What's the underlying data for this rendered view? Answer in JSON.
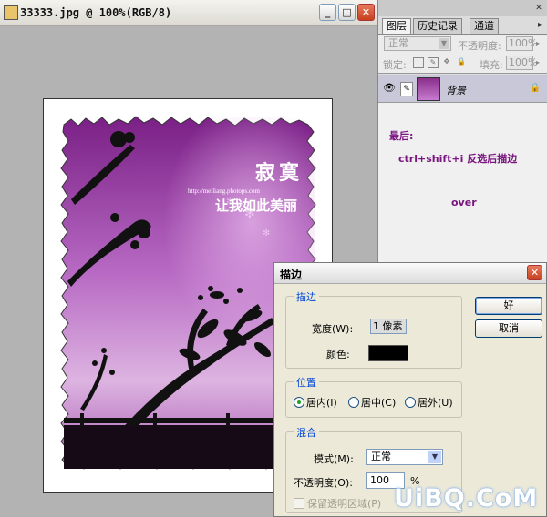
{
  "document": {
    "title": "33333.jpg @ 100%(RGB/8)",
    "controls": {
      "minimize": "_",
      "restore": "□",
      "close": "✕"
    }
  },
  "image": {
    "text_main_1": "寂寞",
    "text_main_2": "让我如此美丽",
    "url": "http://meiliang.photops.com"
  },
  "layers_panel": {
    "tabs": [
      "图层",
      "历史记录",
      "通道"
    ],
    "active_tab": "图层",
    "blend_mode": "正常",
    "opacity_label": "不透明度:",
    "opacity_value": "100%",
    "lock_label": "锁定:",
    "fill_label": "填充:",
    "fill_value": "100%",
    "layer_name": "背景",
    "close": "✕",
    "menu": "▸"
  },
  "notes": {
    "line1": "最后:",
    "line2": "ctrl+shift+i 反选后描边",
    "line3": "over"
  },
  "stroke_dialog": {
    "title": "描边",
    "stroke_group": "描边",
    "width_label": "宽度(W):",
    "width_value": "1 像素",
    "color_label": "颜色:",
    "color_value": "#000000",
    "position_group": "位置",
    "positions": [
      "居内(I)",
      "居中(C)",
      "居外(U)"
    ],
    "selected_position": "居内(I)",
    "blend_group": "混合",
    "mode_label": "模式(M):",
    "mode_value": "正常",
    "opacity_label": "不透明度(O):",
    "opacity_value": "100",
    "opacity_unit": "%",
    "preserve_label": "保留透明区域(P)",
    "ok": "好",
    "cancel": "取消",
    "close": "✕"
  },
  "watermark": "UiBQ.CoM",
  "colors": {
    "accent": "#0046d5",
    "note": "#7a1680",
    "photo_top": "#7a1f86",
    "photo_bottom": "#e3bde6"
  }
}
